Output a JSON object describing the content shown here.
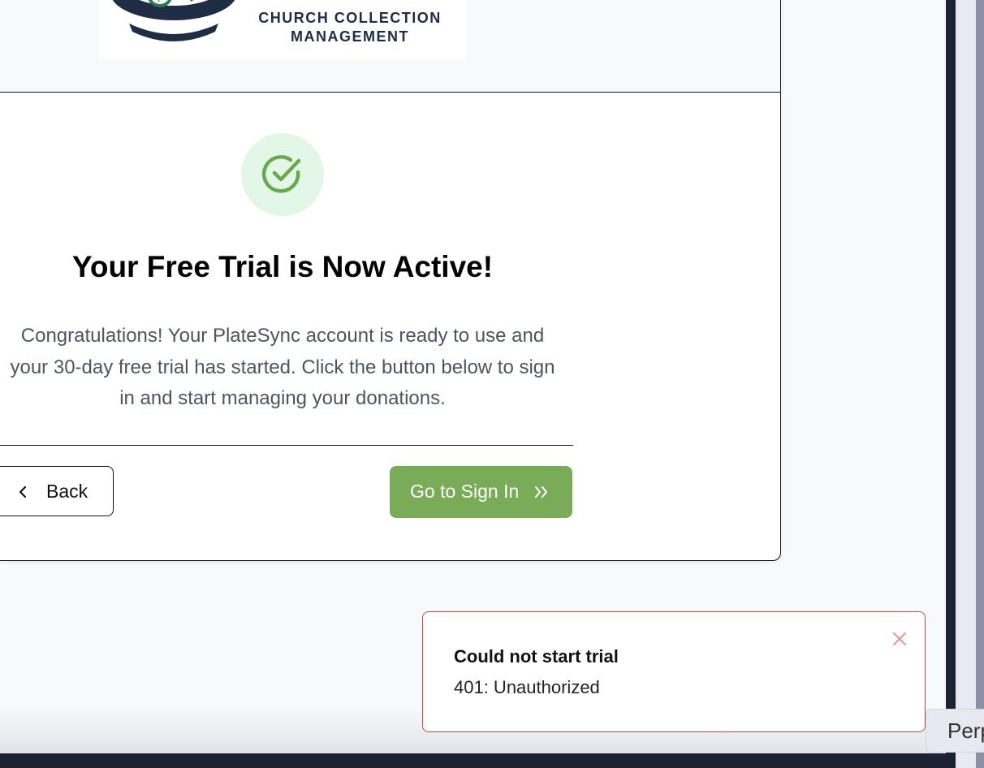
{
  "logo": {
    "line1": "CHURCH COLLECTION",
    "line2": "MANAGEMENT"
  },
  "main": {
    "title": "Your Free Trial is Now Active!",
    "desc_line1": "Congratulations! Your PlateSync account is ready to use and",
    "desc_line2": "your 30-day free trial has started. Click the button below to sign",
    "desc_line3": "in and start managing your donations."
  },
  "buttons": {
    "back_label": "Back",
    "signin_label": "Go to Sign In"
  },
  "toast": {
    "title": "Could not start trial",
    "message": "401: Unauthorized"
  },
  "side_pill": {
    "label": "Perp"
  },
  "colors": {
    "accent_green": "#7aab59",
    "check_bg": "#e3f7e7",
    "error_border": "#d0473a",
    "brand_navy": "#1f2d44"
  },
  "icons": [
    "money-bowl-logo-icon",
    "check-circle-icon",
    "chevron-left-icon",
    "double-chevron-right-icon",
    "close-icon"
  ]
}
